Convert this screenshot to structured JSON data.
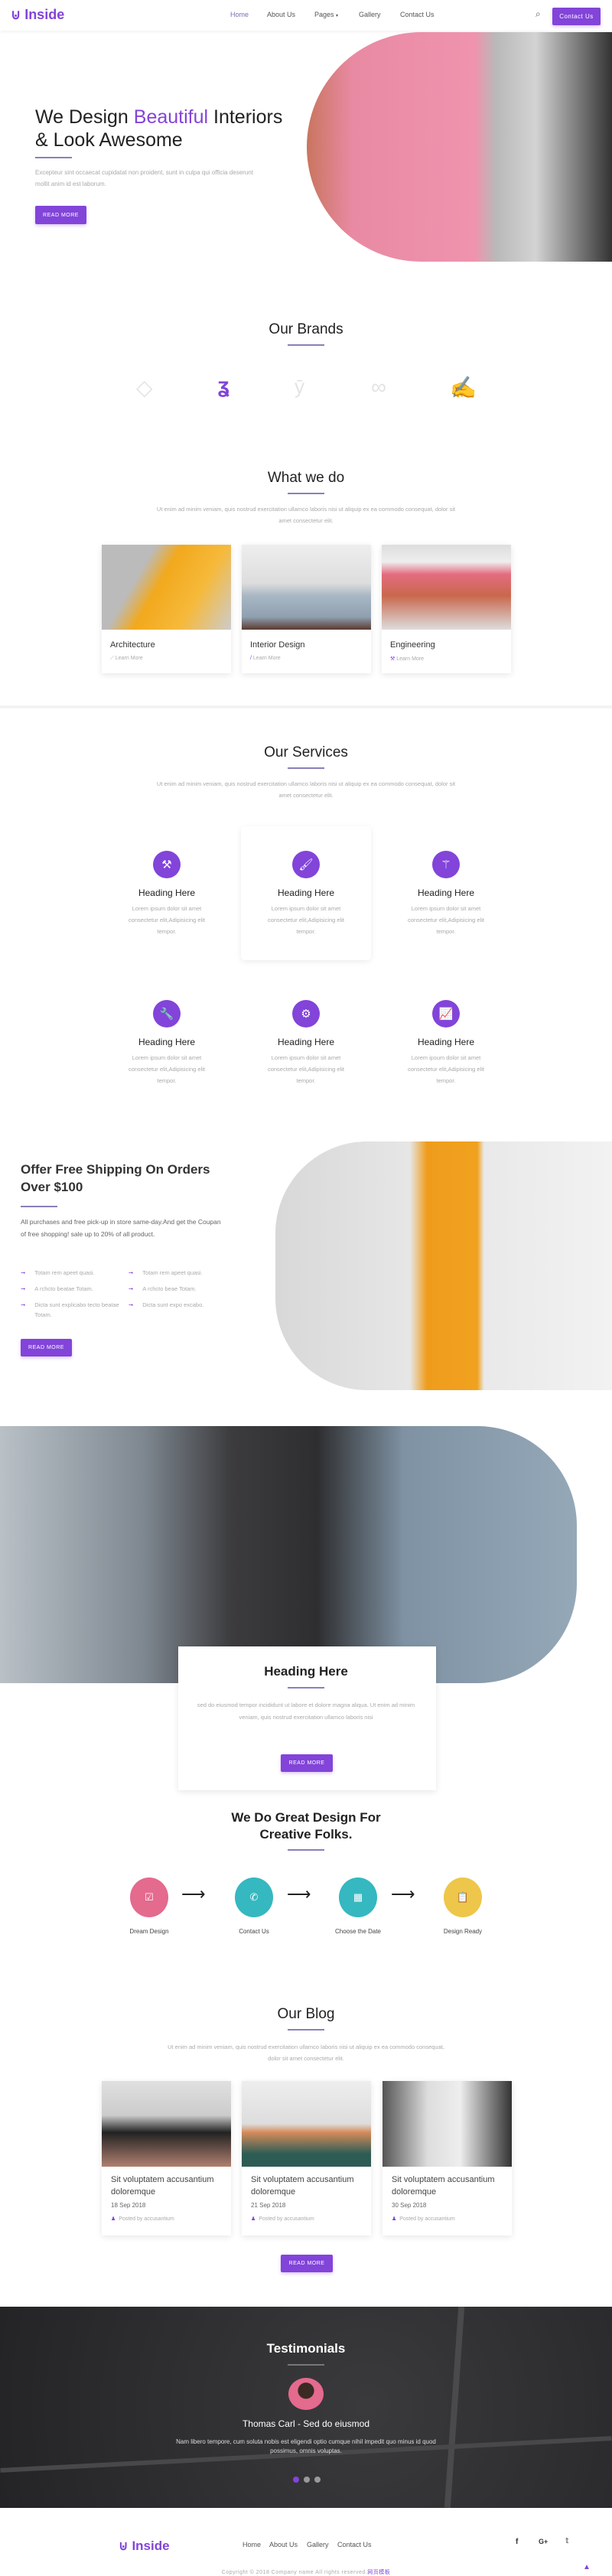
{
  "colors": {
    "accent": "#8244d9",
    "pink": "#e46a8e",
    "teal": "#35b8c0",
    "yellow": "#eec64a",
    "dark": "#2b2b2d"
  },
  "header": {
    "logo": "Inside",
    "nav": [
      "Home",
      "About Us",
      "Pages",
      "Gallery",
      "Contact Us"
    ],
    "active": "Home",
    "cta": "Contact Us"
  },
  "hero": {
    "title_a": "We Design ",
    "title_accent": "Beautiful",
    "title_b": " Interiors",
    "title_c": "& Look Awesome",
    "text": "Excepteur sint occaecat cupidatat non proident, sunt in culpa qui officia deserunt mollit anim id est laborum.",
    "button": "Read More"
  },
  "brands": {
    "title": "Our Brands",
    "logos": [
      "brand-logo-1",
      "brand-logo-2",
      "brand-logo-3",
      "brand-logo-4",
      "brand-logo-5"
    ]
  },
  "whatwedo": {
    "title": "What we do",
    "subtitle": "Ut enim ad minim veniam, quis nostrud exercitation ullamco laboris nisi ut aliquip ex ea commodo consequat, dolor sit amet consectetur elit.",
    "cards": [
      {
        "title": "Architecture",
        "link": "Learn More"
      },
      {
        "title": "Interior Design",
        "link": "Learn More"
      },
      {
        "title": "Engineering",
        "link": "Learn More"
      }
    ]
  },
  "services": {
    "title": "Our Services",
    "subtitle": "Ut enim ad minim veniam, quis nostrud exercitation ullamco laboris nisi ut aliquip ex ea commodo consequat, dolor sit amet consectetur elit.",
    "items": [
      {
        "icon": "hammer-icon",
        "heading": "Heading Here",
        "text": "Lorem ipsum dolor sit amet consectetur elit,Adipisicing elit tempor."
      },
      {
        "icon": "brush-icon",
        "heading": "Heading Here",
        "text": "Lorem ipsum dolor sit amet consectetur elit,Adipisicing elit tempor."
      },
      {
        "icon": "magic-wand-icon",
        "heading": "Heading Here",
        "text": "Lorem ipsum dolor sit amet consectetur elit,Adipisicing elit tempor."
      },
      {
        "icon": "wrench-icon",
        "heading": "Heading Here",
        "text": "Lorem ipsum dolor sit amet consectetur elit,Adipisicing elit tempor."
      },
      {
        "icon": "gears-icon",
        "heading": "Heading Here",
        "text": "Lorem ipsum dolor sit amet consectetur elit,Adipisicing elit tempor."
      },
      {
        "icon": "chart-icon",
        "heading": "Heading Here",
        "text": "Lorem ipsum dolor sit amet consectetur elit,Adipisicing elit tempor."
      }
    ]
  },
  "offer": {
    "title": "Offer Free Shipping On Orders Over $100",
    "text": "All purchases and free pick-up in store same-day.And get the Coupan of free shopping! sale up to 20% of all product.",
    "list": [
      "Totam rem apeet quasi.",
      "Totam rem apeet quasi.",
      "A rchcto beatae Totam.",
      "A rchcto beae Totam.",
      "Dicta sunt explicabo tecto beatae Totam.",
      "Dicta sunt expo excabo."
    ],
    "button": "Read More"
  },
  "feature": {
    "title": "Heading Here",
    "text": "sed do eiusmod tempor incididunt ut labore et dolore magna aliqua. Ut enim ad minim veniam, quis nostrud exercitation ullamco laboris nisi",
    "button": "Read More"
  },
  "process": {
    "title": "We Do Great Design For Creative Folks.",
    "steps": [
      {
        "label": "Dream Design",
        "icon": "checkbox-icon"
      },
      {
        "label": "Contact Us",
        "icon": "phone-icon"
      },
      {
        "label": "Choose the Date",
        "icon": "calendar-icon"
      },
      {
        "label": "Design Ready",
        "icon": "clipboard-icon"
      }
    ]
  },
  "blog": {
    "title": "Our Blog",
    "subtitle": "Ut enim ad minim veniam, quis nostrud exercitation ullamco laboris nisi ut aliquip ex ea commodo consequat, dolor sit amet consectetur elit.",
    "posts": [
      {
        "title": "Sit voluptatem accusantium doloremque",
        "date": "18 Sep 2018",
        "author": "Posted by accusantium"
      },
      {
        "title": "Sit voluptatem accusantium doloremque",
        "date": "21 Sep 2018",
        "author": "Posted by accusantium"
      },
      {
        "title": "Sit voluptatem accusantium doloremque",
        "date": "30 Sep 2018",
        "author": "Posted by accusantium"
      }
    ],
    "button": "Read More"
  },
  "testimonials": {
    "title": "Testimonials",
    "name": "Thomas Carl - Sed do eiusmod",
    "text": "Nam libero tempore, cum soluta nobis est eligendi optio cumque nihil impedit quo minus id quod possimus, omnis voluptas.",
    "active_slide": 1,
    "slides": 3
  },
  "footer": {
    "logo": "Inside",
    "nav": [
      "Home",
      "About Us",
      "Gallery",
      "Contact Us"
    ],
    "social": [
      "facebook-icon",
      "google-plus-icon",
      "twitter-icon"
    ],
    "copyright": "Copyright © 2018 Company name All rights reserved.",
    "copyright_link": "网页模板"
  }
}
